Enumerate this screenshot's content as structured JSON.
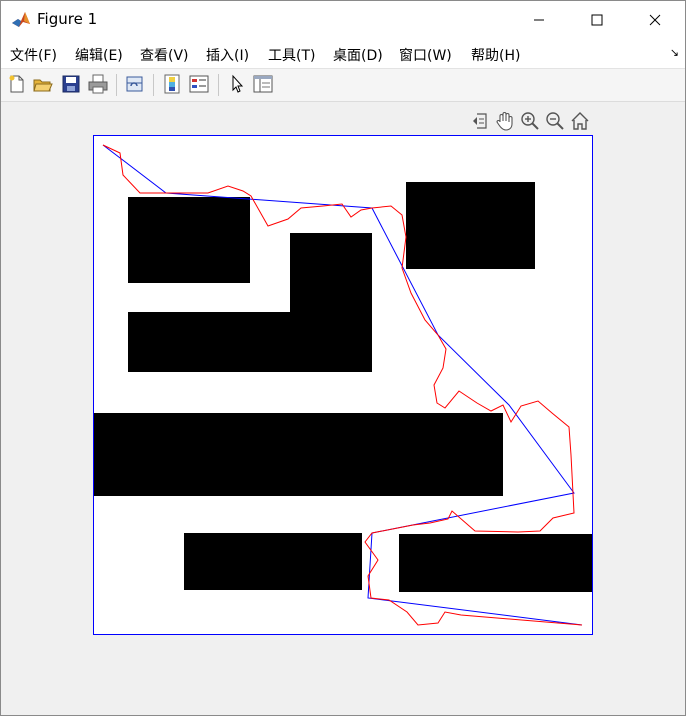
{
  "window": {
    "title": "Figure 1",
    "controls": [
      "minimize",
      "maximize",
      "close"
    ]
  },
  "menu": {
    "items": [
      "文件(F)",
      "编辑(E)",
      "查看(V)",
      "插入(I)",
      "工具(T)",
      "桌面(D)",
      "窗口(W)",
      "帮助(H)"
    ],
    "dock_arrow": "↘"
  },
  "toolbar": {
    "buttons": [
      "new-figure-icon",
      "open-file-icon",
      "save-icon",
      "print-icon",
      "link-plot-icon",
      "insert-colorbar-icon",
      "insert-legend-icon",
      "edit-plot-cursor-icon",
      "property-inspector-icon"
    ]
  },
  "axes_toolbar": {
    "buttons": [
      "export-icon",
      "pan-hand-icon",
      "zoom-in-icon",
      "zoom-out-icon",
      "restore-view-home-icon"
    ]
  },
  "colors": {
    "obstacle": "#000000",
    "path_raw": "#ff0000",
    "path_smoothed": "#0000ff",
    "axes_border": "#0000ff"
  },
  "chart_data": {
    "type": "line",
    "xlim": [
      0,
      500
    ],
    "ylim": [
      0,
      500
    ],
    "y_direction": "down",
    "axes_visible": false,
    "obstacles": [
      {
        "x": [
          35,
          157
        ],
        "y": [
          62,
          148
        ]
      },
      {
        "x": [
          197,
          279
        ],
        "y": [
          98,
          177
        ]
      },
      {
        "x": [
          35,
          279
        ],
        "y": [
          177,
          237
        ]
      },
      {
        "x": [
          313,
          442
        ],
        "y": [
          47,
          134
        ]
      },
      {
        "x": [
          0,
          410
        ],
        "y": [
          278,
          361
        ]
      },
      {
        "x": [
          91,
          269
        ],
        "y": [
          398,
          455
        ]
      },
      {
        "x": [
          306,
          500
        ],
        "y": [
          399,
          457
        ]
      }
    ],
    "series": [
      {
        "color": "#0000ff",
        "x": [
          10,
          73,
          279,
          345,
          416,
          481,
          279,
          275,
          489
        ],
        "y": [
          10,
          58,
          73,
          200,
          270,
          358,
          398,
          463,
          490
        ]
      },
      {
        "color": "#ff0000",
        "x": [
          10,
          27,
          30,
          47,
          73,
          115,
          135,
          150,
          158,
          175,
          195,
          208,
          230,
          249,
          258,
          268,
          279,
          298,
          309,
          313,
          309,
          318,
          332,
          345,
          353,
          350,
          341,
          344,
          352,
          366,
          384,
          398,
          410,
          418,
          428,
          445,
          459,
          476,
          478,
          481,
          460,
          447,
          425,
          382,
          359,
          355,
          337,
          320,
          279,
          272,
          285,
          275,
          278,
          296,
          314,
          325,
          345,
          352,
          368,
          489
        ],
        "y": [
          10,
          18,
          40,
          58,
          58,
          58,
          51,
          56,
          61,
          91,
          84,
          73,
          71,
          69,
          82,
          75,
          73,
          71,
          80,
          102,
          133,
          158,
          185,
          200,
          214,
          233,
          250,
          268,
          273,
          256,
          268,
          276,
          270,
          287,
          271,
          266,
          278,
          292,
          320,
          378,
          383,
          396,
          397,
          396,
          376,
          384,
          388,
          390,
          398,
          407,
          425,
          441,
          463,
          465,
          477,
          490,
          488,
          477,
          480,
          490
        ]
      }
    ]
  }
}
